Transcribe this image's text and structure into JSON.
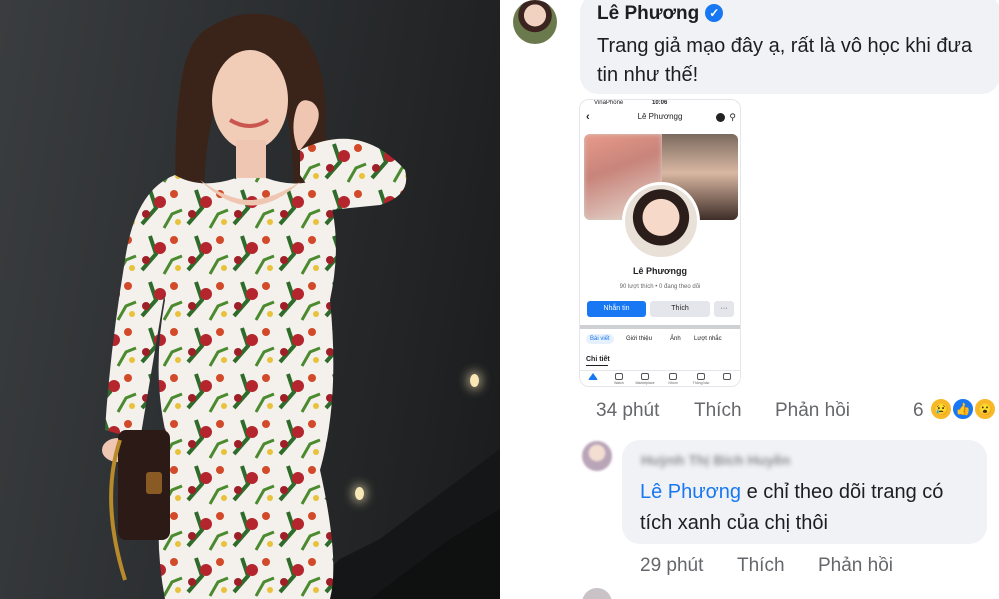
{
  "comment": {
    "author": "Lê Phương",
    "verified_icon": "check-badge-icon",
    "text": "Trang giả mạo đây ạ, rất là vô học khi đưa tin như thế!",
    "actions": {
      "time": "34 phút",
      "like": "Thích",
      "reply": "Phản hồi"
    },
    "reactions": {
      "count": "6",
      "types": [
        "sad",
        "like",
        "wow"
      ]
    }
  },
  "screenshot": {
    "status_carrier": "VinaPhone",
    "status_time": "10:06",
    "page_title": "Lê Phươngg",
    "profile_name": "Lê Phươngg",
    "stats": "90 lượt thích • 0 đang theo dõi",
    "buttons": {
      "message": "Nhắn tin",
      "like": "Thích",
      "more": "···"
    },
    "tabs": [
      "Bài viết",
      "Giới thiệu",
      "Ảnh",
      "Lượt nhắc"
    ],
    "section": "Chi tiết",
    "bottom_nav": [
      "",
      "Watch",
      "Marketplace",
      "Nhóm",
      "Thông báo",
      ""
    ]
  },
  "reply": {
    "author_blurred": "Huỳnh Thị Bích Huyền",
    "mention": "Lê Phương",
    "text": " e chỉ theo dõi trang có tích xanh của chị thôi",
    "actions": {
      "time": "29 phút",
      "like": "Thích",
      "reply": "Phản hồi"
    }
  },
  "colors": {
    "accent": "#1877f2",
    "bubble": "#f0f2f5",
    "muted": "#65676b"
  }
}
